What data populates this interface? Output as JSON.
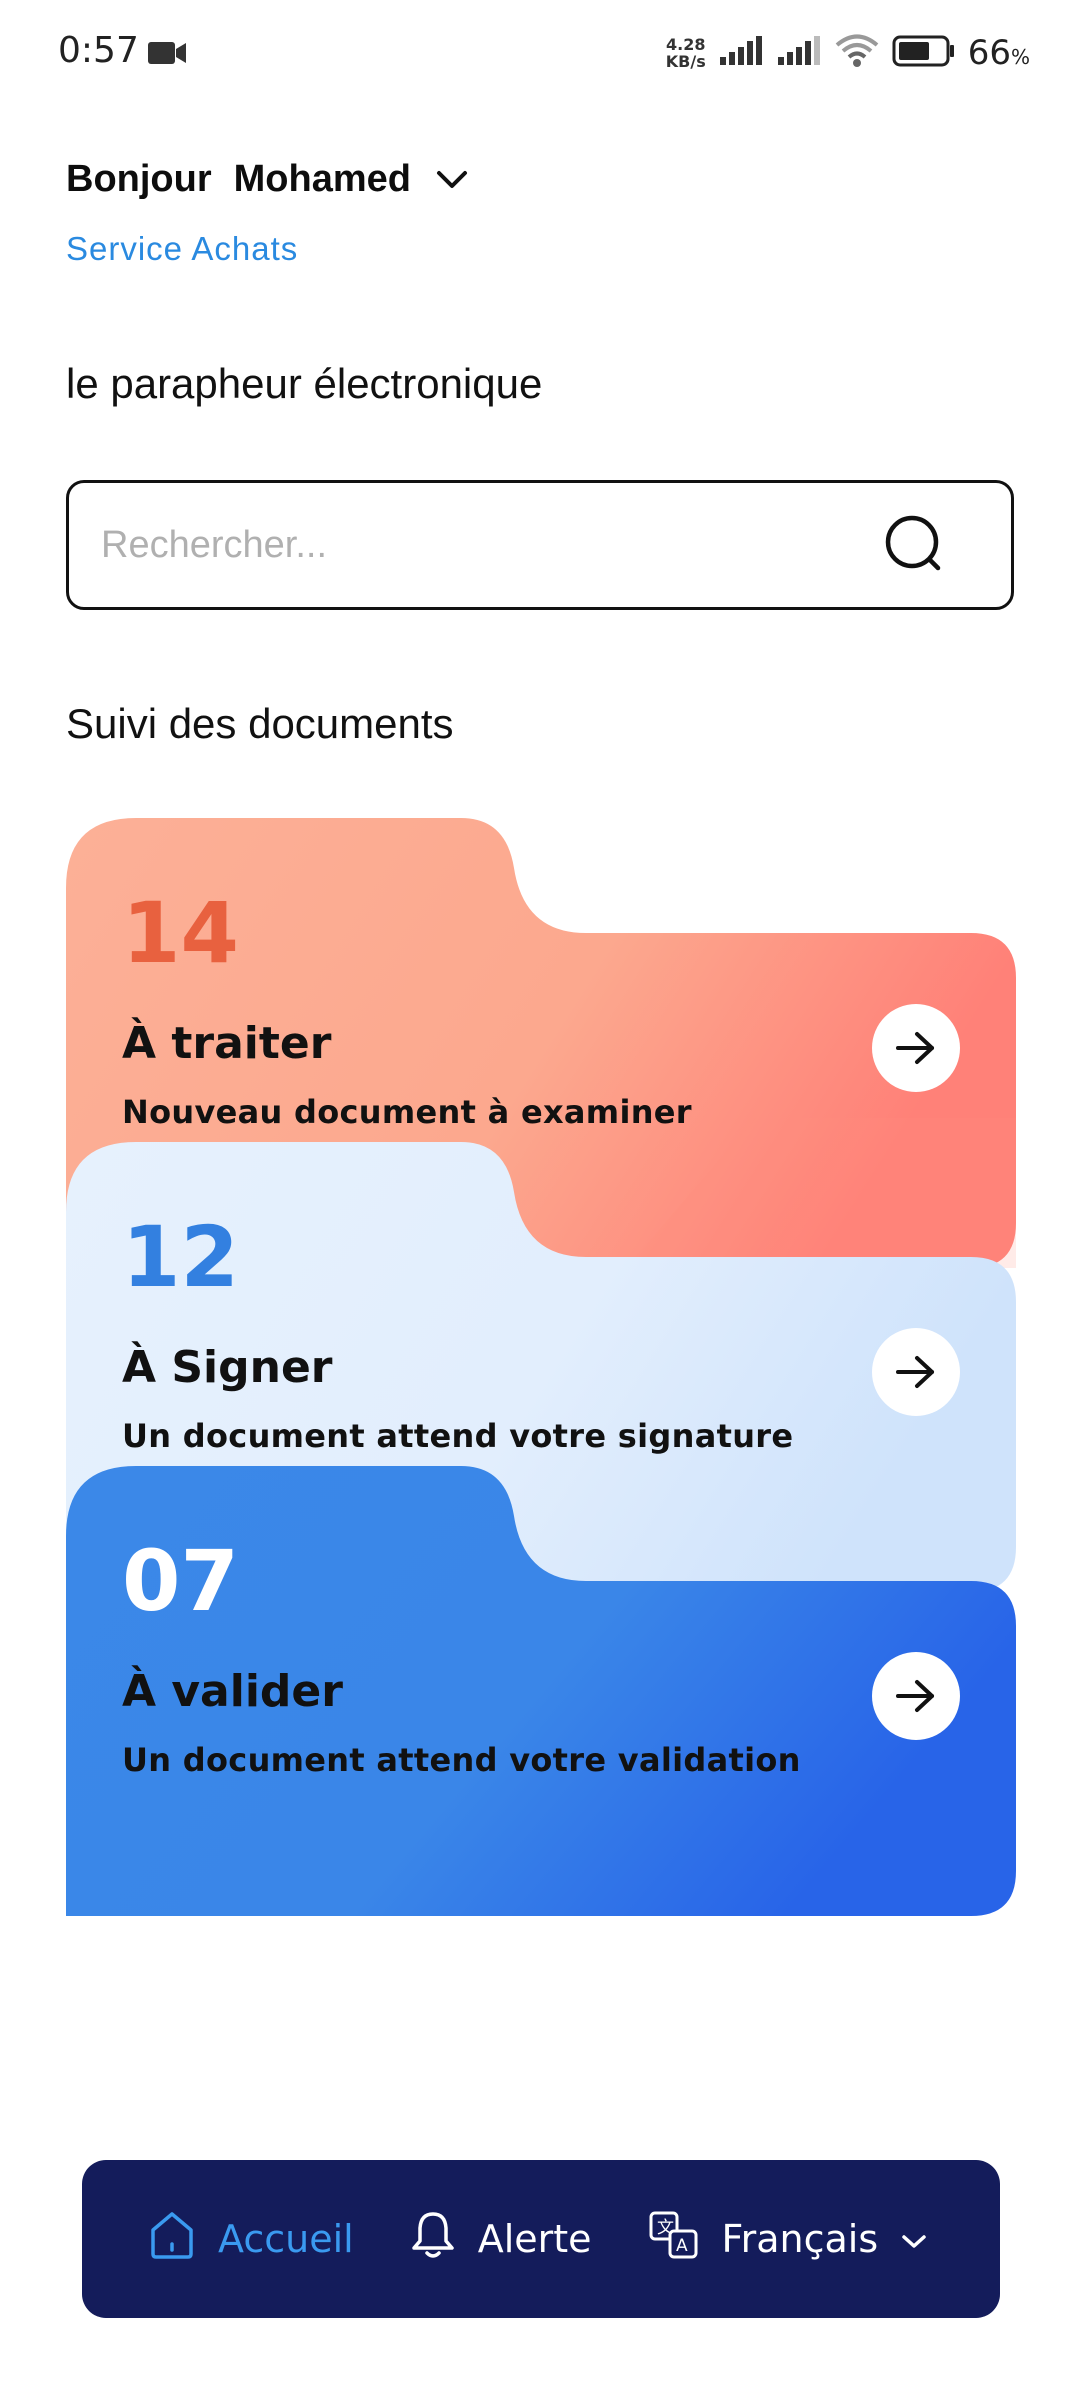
{
  "status_bar": {
    "time": "0:57",
    "net_speed_value": "4.28",
    "net_speed_unit": "KB/s",
    "battery_percent": "66",
    "battery_unit": "%"
  },
  "header": {
    "greeting": "Bonjour",
    "user_name": "Mohamed",
    "service": "Service Achats",
    "subtitle": "le parapheur électronique"
  },
  "search": {
    "placeholder": "Rechercher..."
  },
  "section": {
    "title": "Suivi des documents"
  },
  "cards": [
    {
      "count": "14",
      "title": "À traiter",
      "description": "Nouveau document à examiner",
      "accent": "#e8613f"
    },
    {
      "count": "12",
      "title": "À Signer",
      "description": "Un document attend votre signature",
      "accent": "#3380e0"
    },
    {
      "count": "07",
      "title": "À valider",
      "description": "Un document attend votre validation",
      "accent": "#ffffff"
    }
  ],
  "bottom_nav": {
    "items": [
      {
        "label": "Accueil",
        "icon": "home-icon",
        "active": true
      },
      {
        "label": "Alerte",
        "icon": "bell-icon",
        "active": false
      },
      {
        "label": "Français",
        "icon": "translate-icon",
        "active": false
      }
    ]
  },
  "colors": {
    "brand_blue": "#2a8ae0",
    "nav_bg": "#141c5b",
    "card_orange": "#fcae94",
    "card_light_blue": "#e3effd",
    "card_blue": "#3a86e8"
  }
}
